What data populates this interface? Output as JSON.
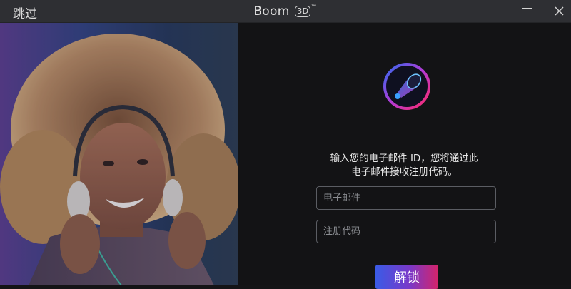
{
  "titlebar": {
    "skip_label": "跳过",
    "app_name": "Boom",
    "app_badge": "3D",
    "trademark": "™"
  },
  "hero_image": {
    "subject": "woman-with-headphones"
  },
  "form": {
    "prompt_line1": "输入您的电子邮件 ID，您将通过此",
    "prompt_line2": "电子邮件接收注册代码。",
    "email_placeholder": "电子邮件",
    "code_placeholder": "注册代码",
    "unlock_label": "解锁"
  },
  "colors": {
    "background": "#131315",
    "titlebar": "#2e2f33",
    "button_gradient_start": "#3a5be6",
    "button_gradient_end": "#d5246a"
  }
}
